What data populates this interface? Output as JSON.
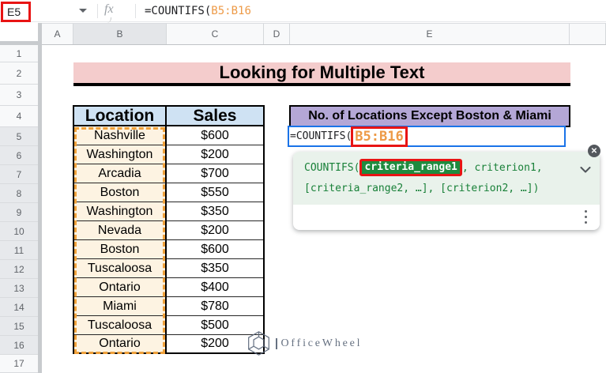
{
  "topbar": {
    "name_box": "E5",
    "fx_label": "fx",
    "formula_prefix": "=COUNTIFS(",
    "formula_range": "B5:B16"
  },
  "grid": {
    "column_letters": [
      "A",
      "B",
      "C",
      "D",
      "E"
    ],
    "row_numbers": [
      "1",
      "2",
      "3",
      "4",
      "5",
      "6",
      "7",
      "8",
      "9",
      "10",
      "11",
      "12",
      "13",
      "14",
      "15",
      "16",
      "17"
    ]
  },
  "title": {
    "text": "Looking for Multiple Text",
    "bg_color": "#f4cccc"
  },
  "table": {
    "headers": {
      "location": "Location",
      "sales": "Sales"
    },
    "rows": [
      {
        "location": "Nashville",
        "sales": "$600"
      },
      {
        "location": "Washington",
        "sales": "$200"
      },
      {
        "location": "Arcadia",
        "sales": "$700"
      },
      {
        "location": "Boston",
        "sales": "$550"
      },
      {
        "location": "Washington",
        "sales": "$350"
      },
      {
        "location": "Nevada",
        "sales": "$200"
      },
      {
        "location": "Boston",
        "sales": "$600"
      },
      {
        "location": "Tuscaloosa",
        "sales": "$350"
      },
      {
        "location": "Ontario",
        "sales": "$400"
      },
      {
        "location": "Miami",
        "sales": "$780"
      },
      {
        "location": "Tuscaloosa",
        "sales": "$500"
      },
      {
        "location": "Ontario",
        "sales": "$200"
      }
    ],
    "header_bg": "#cfe2f3",
    "range_highlight_bg": "#fdf3e2",
    "range_dash_color": "#f0a13a"
  },
  "result": {
    "header": "No. of Locations Except Boston & Miami",
    "header_bg": "#b4a7d6",
    "formula_prefix": "=COUNTIFS(",
    "formula_range": "B5:B16",
    "range_color": "#ed9a47",
    "annotation_color": "#e81414"
  },
  "tooltip": {
    "fn_name": "COUNTIFS(",
    "active_arg": "criteria_range1",
    "line1_rest": ", criterion1,",
    "line2": "[criteria_range2, …], [criterion2, …])",
    "accent_green": "#188038"
  },
  "watermark": {
    "text": "OfficeWheel"
  }
}
